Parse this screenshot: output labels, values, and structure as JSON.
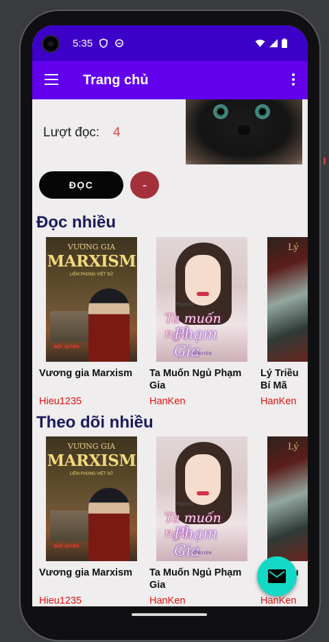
{
  "status_bar": {
    "time": "5:35"
  },
  "app_bar": {
    "title": "Trang chủ"
  },
  "stats": {
    "read_label": "Lượt đọc:",
    "read_count": "4"
  },
  "actions": {
    "read_button": "ĐỌC",
    "minus_button": "-"
  },
  "sections": [
    {
      "title": "Đọc nhiều",
      "books": [
        {
          "title": "Vương gia Marxism",
          "author": "Hieu1235"
        },
        {
          "title": "Ta Muốn Ngủ Phạm Gia",
          "author": "HanKen"
        },
        {
          "title": "Lý Triều Bí Mã",
          "author": "HanKen"
        }
      ]
    },
    {
      "title": "Theo dõi nhiều",
      "books": [
        {
          "title": "Vương gia Marxism",
          "author": "Hieu1235"
        },
        {
          "title": "Ta Muốn Ngủ Phạm Gia",
          "author": "HanKen"
        },
        {
          "title": "Lý Triều Bí Mã",
          "author": "HanKen"
        }
      ]
    }
  ],
  "covers": {
    "marxism": {
      "top": "VƯƠNG GIA",
      "main": "MARXISM",
      "sub": "LIÊM PHONG VIỆT SỬ",
      "badge": "ĐỘC QUYỀN"
    },
    "phamgia": {
      "tag": "ThichVV",
      "line1": "Ta muốn ngủ",
      "line2": "Phạm Gia",
      "brand": "VTRUYEN"
    },
    "lytrieu": {
      "mark": "Lý"
    }
  },
  "colors": {
    "status_bar": "#3d00c8",
    "app_bar": "#6200ee",
    "accent_count": "#e0454a",
    "author": "#e0120e",
    "section_title": "#1a1b5c",
    "fab": "#14d9c6",
    "minus_button": "#a4313a"
  },
  "icons": [
    "menu-icon",
    "more-vert-icon",
    "wifi-icon",
    "signal-icon",
    "battery-icon",
    "mail-icon",
    "shield-icon",
    "notification-icon"
  ]
}
